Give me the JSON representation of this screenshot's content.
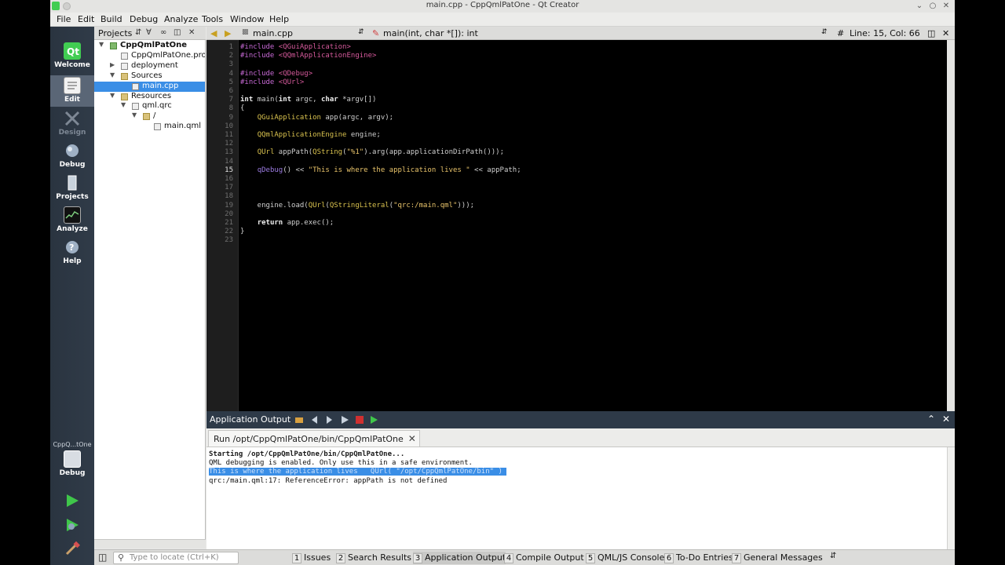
{
  "window": {
    "title": "main.cpp - CppQmlPatOne - Qt Creator"
  },
  "menu": [
    "File",
    "Edit",
    "Build",
    "Debug",
    "Analyze",
    "Tools",
    "Window",
    "Help"
  ],
  "modes": [
    {
      "label": "Welcome"
    },
    {
      "label": "Edit"
    },
    {
      "label": "Design"
    },
    {
      "label": "Debug"
    },
    {
      "label": "Projects"
    },
    {
      "label": "Analyze"
    },
    {
      "label": "Help"
    }
  ],
  "kit": {
    "name": "CppQ...tOne",
    "mode": "Debug"
  },
  "projects_panel": {
    "title": "Projects",
    "tree": [
      {
        "label": "CppQmlPatOne",
        "depth": 0,
        "expanded": true,
        "kind": "proj",
        "bold": true
      },
      {
        "label": "CppQmlPatOne.pro",
        "depth": 1,
        "kind": "file"
      },
      {
        "label": "deployment",
        "depth": 1,
        "expanded": false,
        "kind": "file"
      },
      {
        "label": "Sources",
        "depth": 1,
        "expanded": true,
        "kind": "folder"
      },
      {
        "label": "main.cpp",
        "depth": 2,
        "kind": "file",
        "selected": true
      },
      {
        "label": "Resources",
        "depth": 1,
        "expanded": true,
        "kind": "folder"
      },
      {
        "label": "qml.qrc",
        "depth": 2,
        "expanded": true,
        "kind": "file"
      },
      {
        "label": "/",
        "depth": 3,
        "expanded": true,
        "kind": "folder"
      },
      {
        "label": "main.qml",
        "depth": 4,
        "kind": "file"
      }
    ]
  },
  "editor_toolbar": {
    "file": "main.cpp",
    "symbol": "main(int, char *[]): int",
    "position": "Line: 15, Col: 66"
  },
  "editor": {
    "current_line": 15,
    "lines": [
      "#include <QGuiApplication>",
      "#include <QQmlApplicationEngine>",
      "",
      "#include <QDebug>",
      "#include <QUrl>",
      "",
      "int main(int argc, char *argv[])",
      "{",
      "    QGuiApplication app(argc, argv);",
      "",
      "    QQmlApplicationEngine engine;",
      "",
      "    QUrl appPath(QString(\"%1\").arg(app.applicationDirPath()));",
      "",
      "    qDebug() << \"This is where the application lives \" << appPath;",
      "",
      "",
      "",
      "    engine.load(QUrl(QStringLiteral(\"qrc:/main.qml\")));",
      "",
      "    return app.exec();",
      "}",
      ""
    ]
  },
  "output": {
    "pane_title": "Application Output",
    "tab_label": "Run /opt/CppQmlPatOne/bin/CppQmlPatOne",
    "lines": [
      {
        "text": "Starting /opt/CppQmlPatOne/bin/CppQmlPatOne...",
        "style": "bold"
      },
      {
        "text": "QML debugging is enabled. Only use this in a safe environment.",
        "style": "normal"
      },
      {
        "text": "This is where the application lives   QUrl( \"/opt/CppQmlPatOne/bin\" ) ",
        "style": "sel"
      },
      {
        "text": "qrc:/main.qml:17: ReferenceError: appPath is not defined",
        "style": "normal"
      }
    ]
  },
  "statusbar": {
    "locator_placeholder": "Type to locate (Ctrl+K)",
    "panes": [
      {
        "num": "1",
        "label": "Issues"
      },
      {
        "num": "2",
        "label": "Search Results"
      },
      {
        "num": "3",
        "label": "Application Output",
        "active": true
      },
      {
        "num": "4",
        "label": "Compile Output"
      },
      {
        "num": "5",
        "label": "QML/JS Console"
      },
      {
        "num": "6",
        "label": "To-Do Entries"
      },
      {
        "num": "7",
        "label": "General Messages"
      }
    ]
  },
  "colors": {
    "modebar": "#2a3440",
    "accent_green": "#41cd52",
    "selection": "#3a8ee6",
    "editor_bg": "#000000"
  }
}
